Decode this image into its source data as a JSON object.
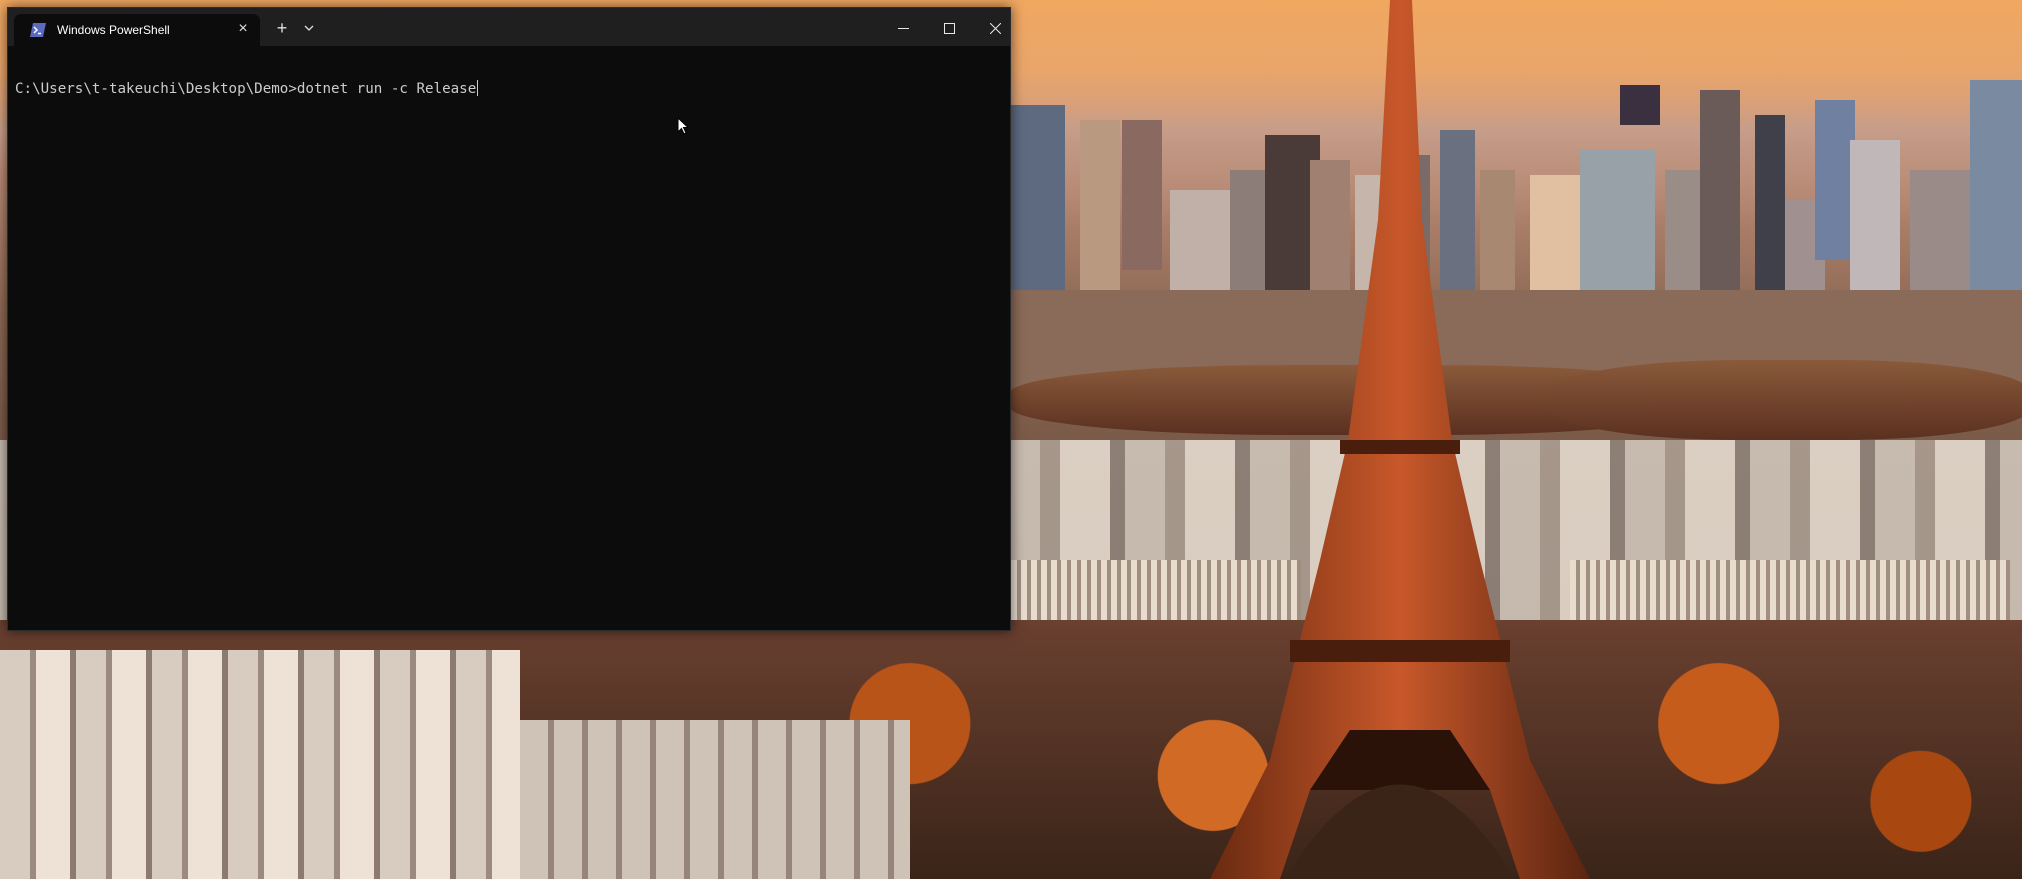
{
  "window": {
    "tab_title": "Windows PowerShell",
    "tab_icon": "powershell-icon",
    "new_tab_icon": "plus-icon",
    "dropdown_icon": "chevron-down-icon",
    "controls": {
      "minimize_icon": "minimize-icon",
      "maximize_icon": "maximize-icon",
      "close_icon": "close-icon"
    }
  },
  "console": {
    "prompt": "C:\\Users\\t-takeuchi\\Desktop\\Demo>",
    "command": "dotnet run -c Release"
  },
  "desktop": {
    "wallpaper": "Eiffel Tower at sunset over Paris"
  },
  "colors": {
    "terminal_bg": "#0c0c0c",
    "titlebar_bg": "#1f1f1f",
    "text": "#cccccc"
  }
}
